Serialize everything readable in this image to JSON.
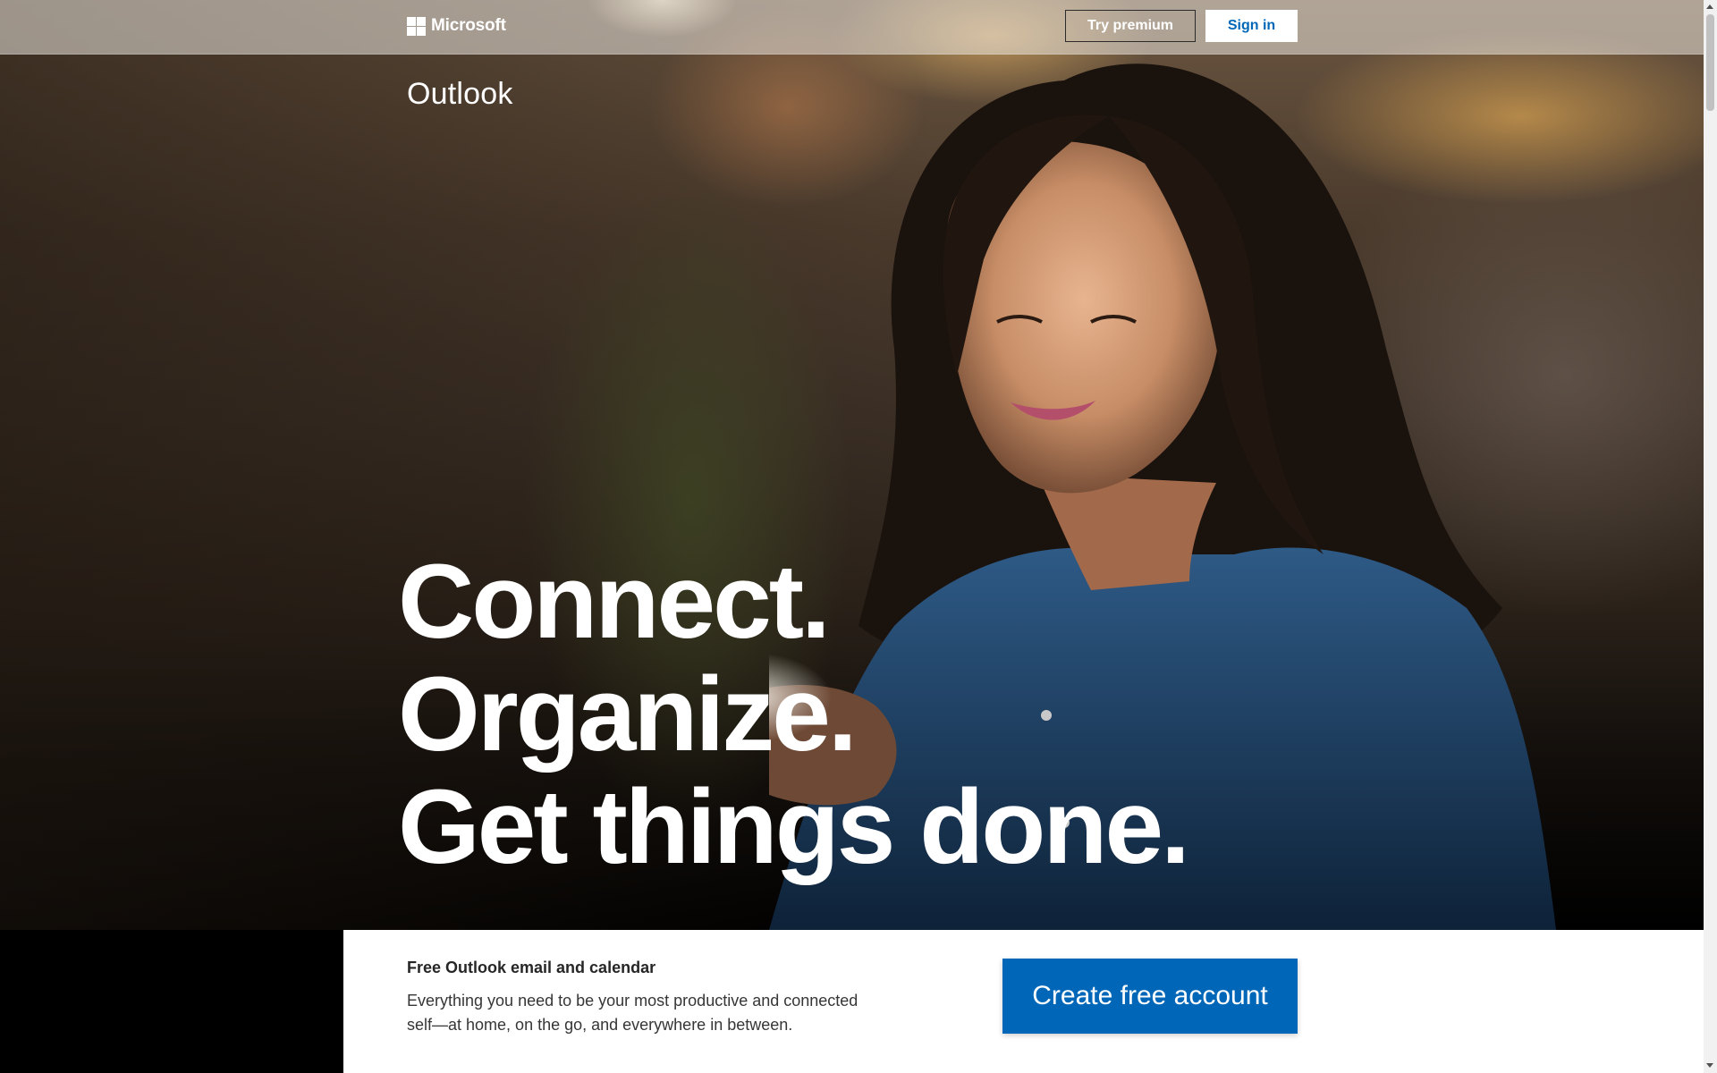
{
  "header": {
    "brand": "Microsoft",
    "try_premium_label": "Try premium",
    "sign_in_label": "Sign in"
  },
  "hero": {
    "product_name": "Outlook",
    "headline_lines": [
      "Connect.",
      "Organize.",
      "Get things done."
    ]
  },
  "info": {
    "title": "Free Outlook email and calendar",
    "body": "Everything you need to be your most productive and connected self—at home, on the go, and everywhere in between.",
    "cta_label": "Create free account"
  },
  "colors": {
    "accent_blue": "#0067b8",
    "panel_background": "#ffffff"
  },
  "icons": {
    "logo": "microsoft-logo-icon"
  }
}
